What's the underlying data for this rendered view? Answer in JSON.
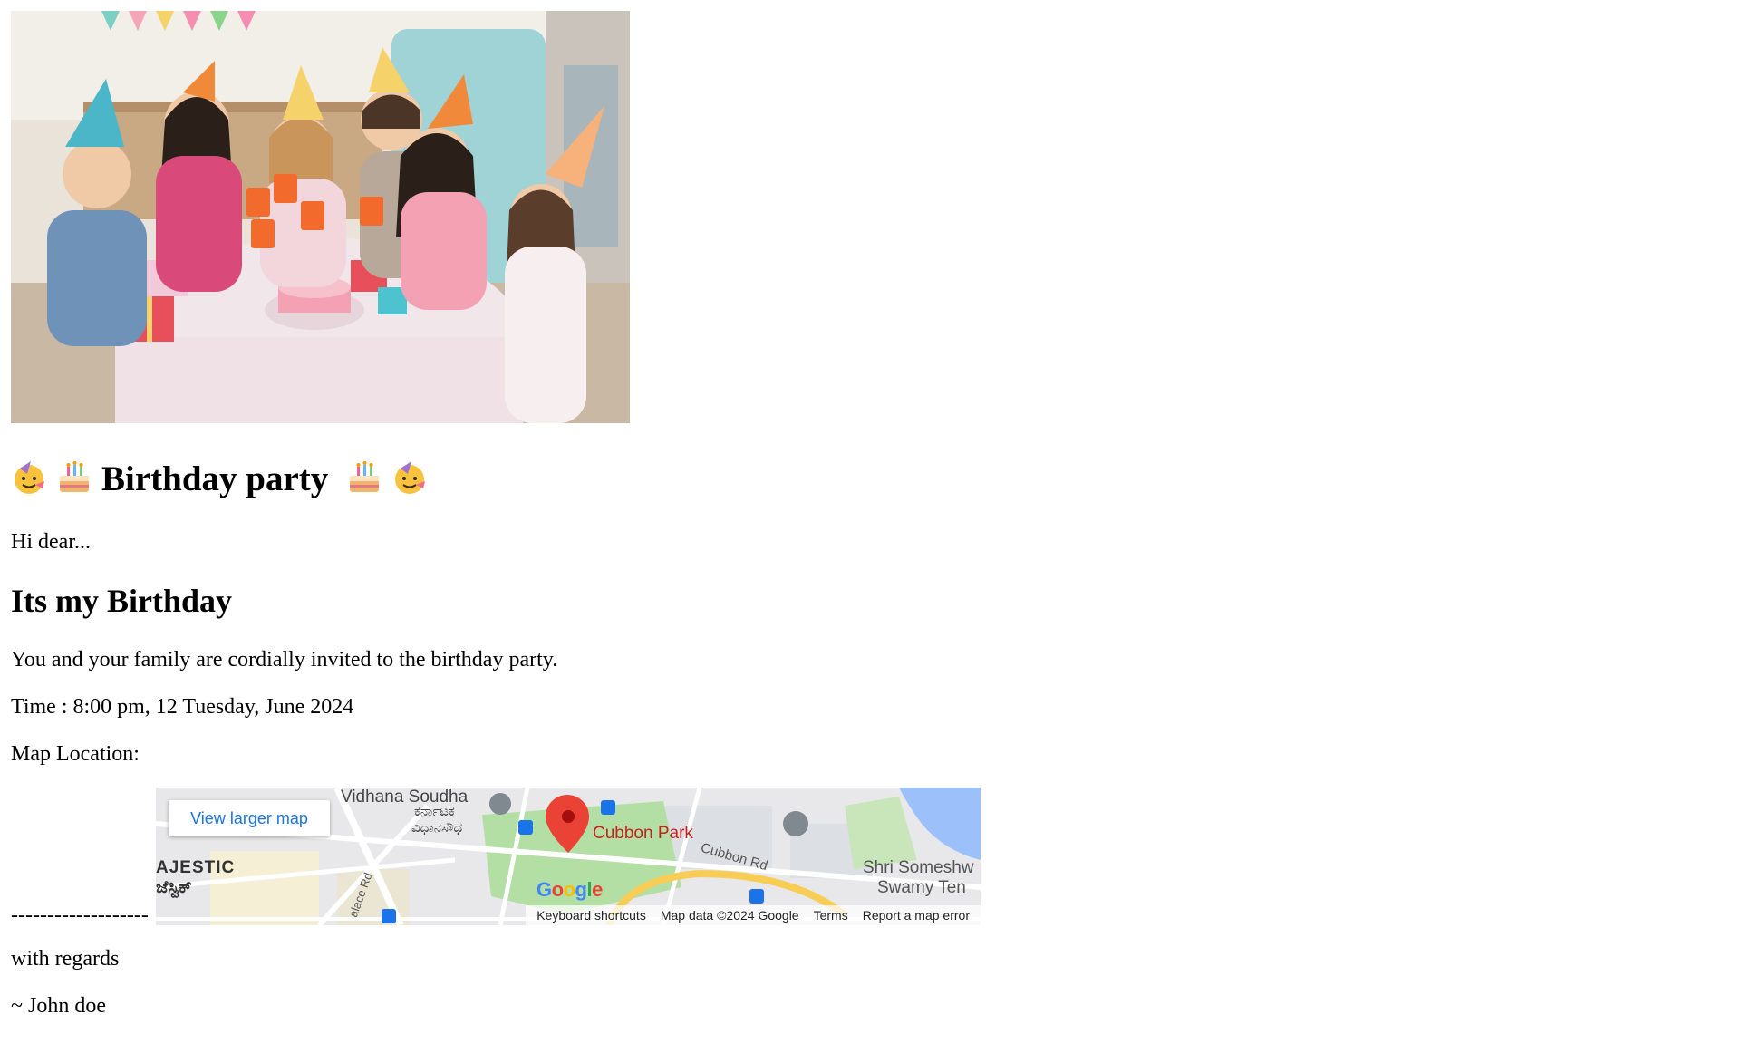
{
  "title": {
    "text": "Birthday party",
    "left_emojis": [
      "party-face-icon",
      "birthday-cake-icon"
    ],
    "right_emojis": [
      "birthday-cake-icon",
      "party-face-icon"
    ]
  },
  "greeting": "Hi dear...",
  "headline": "Its my Birthday",
  "invitation": "You and your family are cordially invited to the birthday party.",
  "time": "Time : 8:00 pm, 12 Tuesday, June 2024",
  "map_location_label": "Map Location:",
  "separator": "-------------------",
  "map": {
    "view_larger": "View larger map",
    "place_name": "Cubbon Park",
    "labels": {
      "vidhana": "Vidhana Soudha",
      "vidhana_kn1": "ಕರ್ನಾಟಕ",
      "vidhana_kn2": "ವಿಧಾನಸೌಧ",
      "cubbon_rd": "Cubbon Rd",
      "shri1": "Shri Someshw",
      "shri2": "Swamy Ten",
      "majestic": "AJESTIC",
      "majestic_kn": "ಜೆಸ್ಟಿಕ್",
      "palace_rd": "alace Rd"
    },
    "footer": {
      "shortcuts": "Keyboard shortcuts",
      "data": "Map data ©2024 Google",
      "terms": "Terms",
      "report": "Report a map error"
    },
    "colors": {
      "park_green": "#b3dfa4",
      "pin_red": "#ea4335",
      "water_blue": "#9cc0f9",
      "road_yellow": "#f7cd55",
      "metro_blue": "#1a73e8"
    }
  },
  "closing": "with regards",
  "signature": "~ John doe"
}
